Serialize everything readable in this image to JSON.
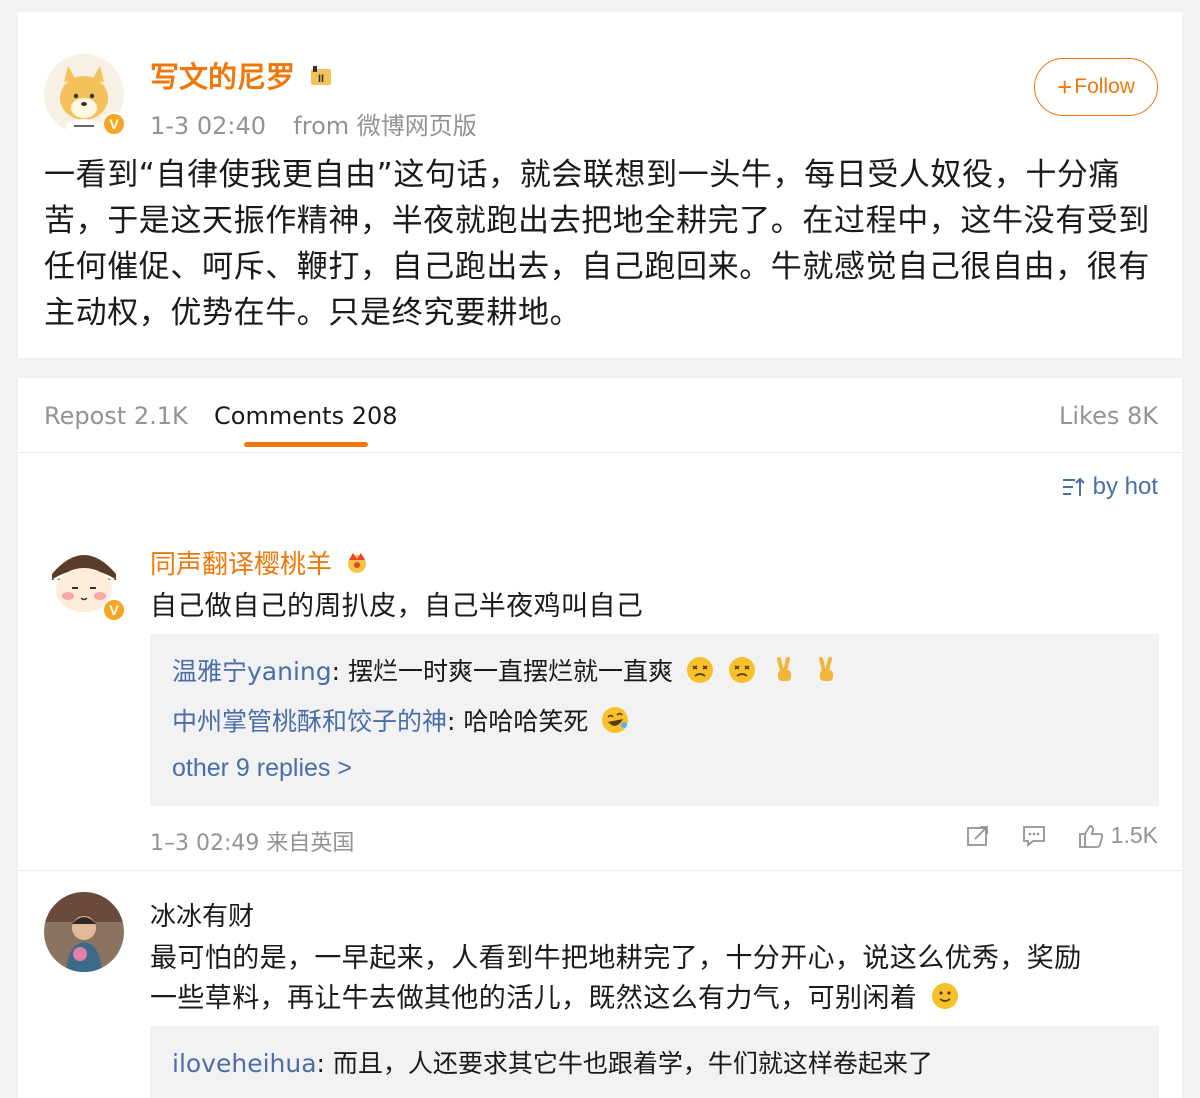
{
  "post": {
    "author": "写文的尼罗",
    "time": "1-3 02:40",
    "source": "from 微博网页版",
    "follow_label": "Follow",
    "text": "一看到“自律使我更自由”这句话，就会联想到一头牛，每日受人奴役，十分痛苦，于是这天振作精神，半夜就跑出去把地全耕完了。在过程中，这牛没有受到任何催促、呵斥、鞭打，自己跑出去，自己跑回来。牛就感觉自己很自由，很有主动权，优势在牛。只是终究要耕地。"
  },
  "tabs": {
    "repost": "Repost 2.1K",
    "comments": "Comments 208",
    "likes": "Likes 8K"
  },
  "sort_label": "by hot",
  "comments": [
    {
      "name": "同声翻译樱桃羊",
      "text": "自己做自己的周扒皮，自己半夜鸡叫自己",
      "replies": [
        {
          "name": "温雅宁yaning",
          "text": "摆烂一时爽一直摆烂就一直爽"
        },
        {
          "name": "中州掌管桃酥和饺子的神",
          "text": "哈哈哈笑死"
        }
      ],
      "more_replies": "other 9 replies >",
      "time": "1–3 02:49 来自英国",
      "likes": "1.5K"
    },
    {
      "name": "冰冰有财",
      "text_line1": "最可怕的是，一早起来，人看到牛把地耕完了，十分开心，说这么优秀，奖励",
      "text_line2": "一些草料，再让牛去做其他的活儿，既然这么有力气，可别闲着",
      "replies": [
        {
          "name": "iloveheihua",
          "text": "而且，人还要求其它牛也跟着学，牛们就这样卷起来了"
        }
      ]
    }
  ],
  "colors": {
    "accent_orange": "#f0780a",
    "link_blue": "#4a6ea8",
    "muted_gray": "#939393"
  }
}
